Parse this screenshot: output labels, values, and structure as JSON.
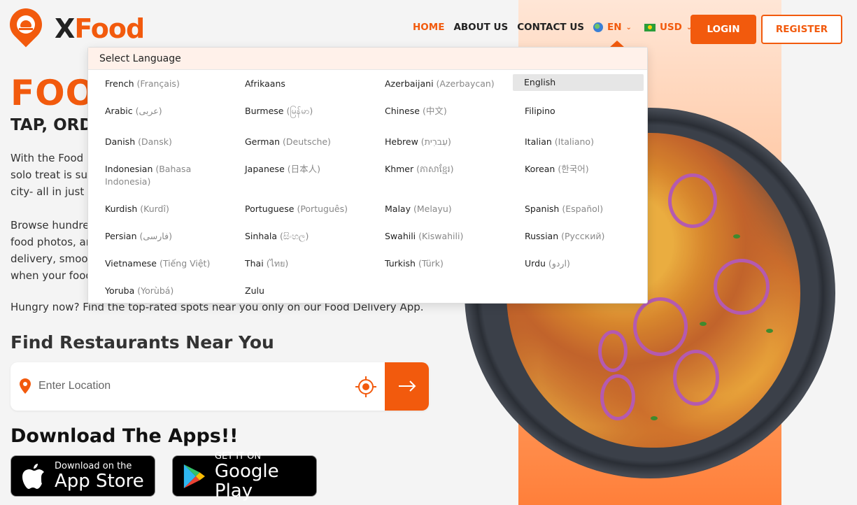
{
  "brand": {
    "x": "X",
    "name": "Food"
  },
  "nav": {
    "home": "HOME",
    "about": "ABOUT US",
    "contact": "CONTACT US",
    "language": "EN",
    "currency": "USD",
    "login": "LOGIN",
    "register": "REGISTER"
  },
  "hero": {
    "title": "FOO",
    "subtitle": "TAP, ORD",
    "p1_lines": [
      "With the Food D",
      "solo treat is sup",
      "city- all in just c"
    ],
    "p2_lines": [
      "Browse hundre",
      "food photos, ar",
      "delivery, smoot",
      "when your food"
    ],
    "p3": "Hungry now? Find the top-rated spots near you only on our Food Delivery App."
  },
  "search": {
    "title": "Find Restaurants Near You",
    "placeholder": "Enter Location"
  },
  "apps": {
    "title": "Download The Apps!!",
    "apple_small": "Download on the",
    "apple_big": "App Store",
    "google_small": "GET IT ON",
    "google_big": "Google Play"
  },
  "language_menu": {
    "heading": "Select Language",
    "items": [
      {
        "name": "French",
        "native": "(Français)"
      },
      {
        "name": "Afrikaans",
        "native": ""
      },
      {
        "name": "Azerbaijani",
        "native": "(Azerbaycan)"
      },
      {
        "name": "English",
        "native": ""
      },
      {
        "name": "Arabic",
        "native": "(عربى)"
      },
      {
        "name": "Burmese",
        "native": "(မြန်မာ)"
      },
      {
        "name": "Chinese",
        "native": "(中文)"
      },
      {
        "name": "Filipino",
        "native": ""
      },
      {
        "name": "Danish",
        "native": "(Dansk)"
      },
      {
        "name": "German",
        "native": "(Deutsche)"
      },
      {
        "name": "Hebrew",
        "native": "(עִברִית)"
      },
      {
        "name": "Italian",
        "native": "(Italiano)"
      },
      {
        "name": "Indonesian",
        "native": "(Bahasa Indonesia)"
      },
      {
        "name": "Japanese",
        "native": "(日本人)"
      },
      {
        "name": "Khmer",
        "native": "(ភាសាខ្មែរ)"
      },
      {
        "name": "Korean",
        "native": "(한국어)"
      },
      {
        "name": "Kurdish",
        "native": "(Kurdî)"
      },
      {
        "name": "Portuguese",
        "native": "(Português)"
      },
      {
        "name": "Malay",
        "native": "(Melayu)"
      },
      {
        "name": "Spanish",
        "native": "(Español)"
      },
      {
        "name": "Persian",
        "native": "(فارسی)"
      },
      {
        "name": "Sinhala",
        "native": "(සිංහල)"
      },
      {
        "name": "Swahili",
        "native": "(Kiswahili)"
      },
      {
        "name": "Russian",
        "native": "(Русский)"
      },
      {
        "name": "Vietnamese",
        "native": "(Tiếng Việt)"
      },
      {
        "name": "Thai",
        "native": "(ไทย)"
      },
      {
        "name": "Turkish",
        "native": "(Türk)"
      },
      {
        "name": "Urdu",
        "native": "(اردو)"
      },
      {
        "name": "Yoruba",
        "native": "(Yorùbá)"
      },
      {
        "name": "Zulu",
        "native": ""
      }
    ],
    "selected": "English"
  },
  "colors": {
    "accent": "#f25a0d"
  }
}
